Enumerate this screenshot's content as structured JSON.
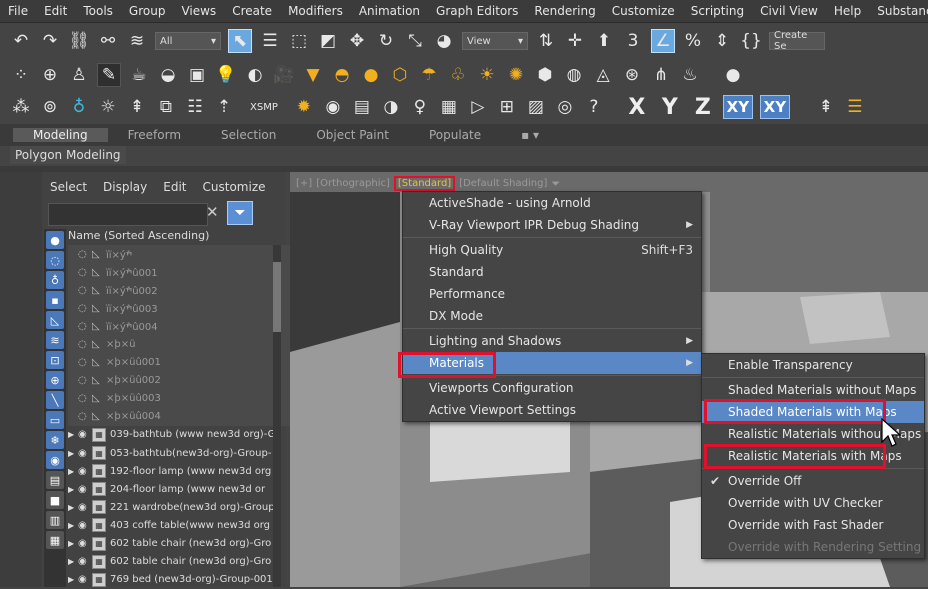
{
  "menubar": [
    "File",
    "Edit",
    "Tools",
    "Group",
    "Views",
    "Create",
    "Modifiers",
    "Animation",
    "Graph Editors",
    "Rendering",
    "Customize",
    "Scripting",
    "Civil View",
    "Help",
    "Substance"
  ],
  "toolbar1": {
    "selection_filter": "All",
    "ref_coord": "View",
    "create_selection_set": "Create Se"
  },
  "toolbar3": {
    "xsmp_label": "XSMP",
    "axes": [
      "X",
      "Y",
      "Z",
      "XY",
      "XY"
    ]
  },
  "ribbon": {
    "tabs": [
      "Modeling",
      "Freeform",
      "Selection",
      "Object Paint",
      "Populate"
    ],
    "panel_label": "Polygon Modeling"
  },
  "explorer": {
    "menu": [
      "Select",
      "Display",
      "Edit",
      "Customize"
    ],
    "column_header": "Name (Sorted Ascending)",
    "search_value": "",
    "rows": [
      {
        "name": "ïï×ýׯ",
        "dim": true
      },
      {
        "name": "ïï×ýׯû001",
        "dim": true
      },
      {
        "name": "ïï×ýׯû002",
        "dim": true
      },
      {
        "name": "ïï×ýׯû003",
        "dim": true
      },
      {
        "name": "ïï×ýׯû004",
        "dim": true
      },
      {
        "name": "×þ×ü",
        "dim": true
      },
      {
        "name": "×þ×üû001",
        "dim": true
      },
      {
        "name": "×þ×üû002",
        "dim": true
      },
      {
        "name": "×þ×üû003",
        "dim": true
      },
      {
        "name": "×þ×üû004",
        "dim": true
      },
      {
        "name": "039-bathtub (www new3d org)-G",
        "dim": false
      },
      {
        "name": "053-bathtub(new3d-org)-Group-",
        "dim": false
      },
      {
        "name": "192-floor lamp (www new3d org",
        "dim": false
      },
      {
        "name": "204-floor lamp  (www new3d or",
        "dim": false
      },
      {
        "name": "221 wardrobe(new3d org)-Group",
        "dim": false
      },
      {
        "name": "403 coffe table(www new3d org",
        "dim": false
      },
      {
        "name": "602 table chair (new3d org)-Gro",
        "dim": false
      },
      {
        "name": "602 table chair (new3d org)-Gro",
        "dim": false
      },
      {
        "name": "769 bed (new3d-org)-Group-001",
        "dim": false
      }
    ]
  },
  "viewport": {
    "label_parts": [
      "[+]",
      "[Orthographic]",
      "[Standard]",
      "[Default Shading]"
    ]
  },
  "context_menu": [
    {
      "label": "ActiveShade - using Arnold",
      "submenu": false,
      "shortcut": ""
    },
    {
      "label": "V-Ray Viewport IPR Debug Shading",
      "submenu": true,
      "shortcut": ""
    },
    {
      "sep": true
    },
    {
      "label": "High Quality",
      "submenu": false,
      "shortcut": "Shift+F3"
    },
    {
      "label": "Standard",
      "submenu": false,
      "shortcut": ""
    },
    {
      "label": "Performance",
      "submenu": false,
      "shortcut": ""
    },
    {
      "label": "DX Mode",
      "submenu": false,
      "shortcut": ""
    },
    {
      "sep": true
    },
    {
      "label": "Lighting and Shadows",
      "submenu": true,
      "shortcut": ""
    },
    {
      "label": "Materials",
      "submenu": true,
      "shortcut": "",
      "highlighted": true
    },
    {
      "sep": true
    },
    {
      "label": "Viewports Configuration",
      "submenu": false,
      "shortcut": ""
    },
    {
      "label": "Active Viewport Settings",
      "submenu": false,
      "shortcut": ""
    }
  ],
  "submenu": [
    {
      "label": "Enable Transparency"
    },
    {
      "sep": true
    },
    {
      "label": "Shaded Materials without Maps"
    },
    {
      "label": "Shaded Materials with Maps",
      "highlighted": true
    },
    {
      "label": "Realistic Materials without Maps"
    },
    {
      "label": "Realistic Materials with Maps"
    },
    {
      "sep": true
    },
    {
      "label": "Override Off",
      "checked": true
    },
    {
      "label": "Override with UV Checker"
    },
    {
      "label": "Override with Fast Shader"
    },
    {
      "label": "Override with Rendering Setting",
      "disabled": true
    }
  ],
  "colors": {
    "highlight": "#5a87c6",
    "annotation_red": "#e0112c",
    "standard_label": "#e9c040"
  }
}
